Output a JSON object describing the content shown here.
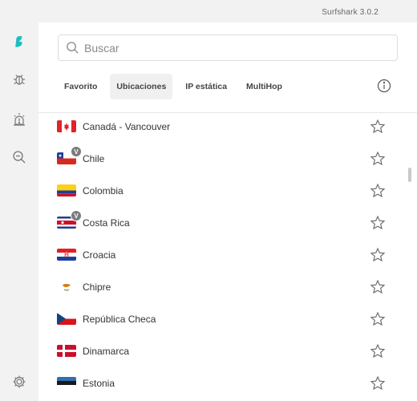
{
  "app": {
    "title": "Surfshark 3.0.2"
  },
  "sidebar": {
    "items": [
      {
        "icon": "surfshark-logo-icon"
      },
      {
        "icon": "bug-icon"
      },
      {
        "icon": "alert-icon"
      },
      {
        "icon": "search-zoom-icon"
      },
      {
        "icon": "gear-icon"
      }
    ]
  },
  "search": {
    "placeholder": "Buscar",
    "value": ""
  },
  "tabs": [
    {
      "label": "Favorito",
      "active": false
    },
    {
      "label": "Ubicaciones",
      "active": true
    },
    {
      "label": "IP estática",
      "active": false
    },
    {
      "label": "MultiHop",
      "active": false
    }
  ],
  "info_icon": "info-icon",
  "locations": [
    {
      "name": "Canadá - Vancouver",
      "flag": "canada",
      "virtual": false,
      "favorite": false
    },
    {
      "name": "Chile",
      "flag": "chile",
      "virtual": true,
      "badge": "V",
      "favorite": false
    },
    {
      "name": "Colombia",
      "flag": "colombia",
      "virtual": false,
      "favorite": false
    },
    {
      "name": "Costa Rica",
      "flag": "costa-rica",
      "virtual": true,
      "badge": "V",
      "favorite": false
    },
    {
      "name": "Croacia",
      "flag": "croatia",
      "virtual": false,
      "favorite": false
    },
    {
      "name": "Chipre",
      "flag": "cyprus",
      "virtual": false,
      "favorite": false
    },
    {
      "name": "República Checa",
      "flag": "czech-republic",
      "virtual": false,
      "favorite": false
    },
    {
      "name": "Dinamarca",
      "flag": "denmark",
      "virtual": false,
      "favorite": false
    },
    {
      "name": "Estonia",
      "flag": "estonia",
      "virtual": false,
      "favorite": false
    }
  ],
  "colors": {
    "sidebar_bg": "#f2f2f2",
    "accent": "#1ebdc1",
    "icon_gray": "#777777"
  }
}
